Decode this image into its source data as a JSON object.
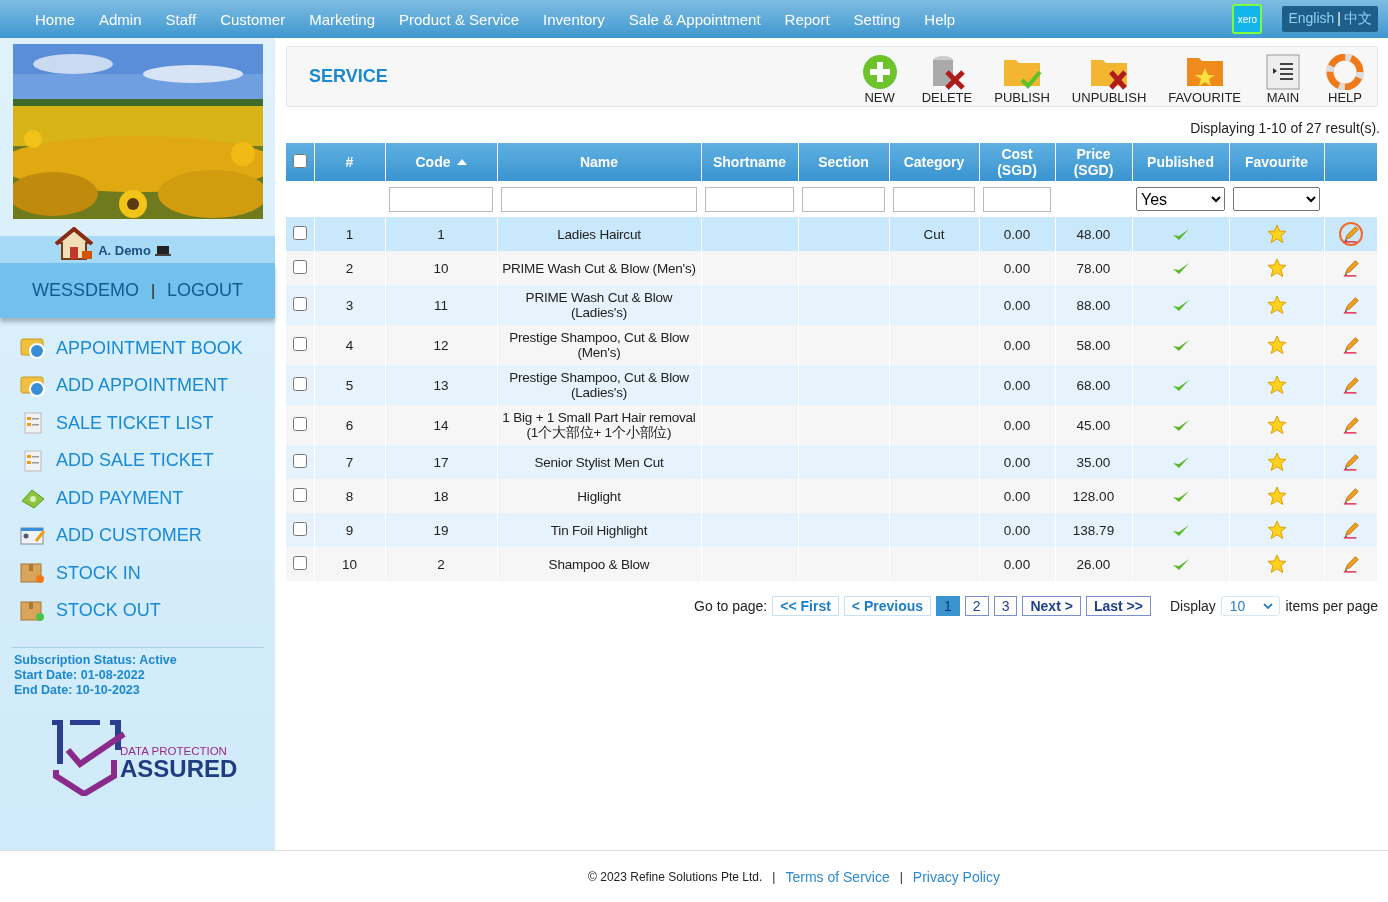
{
  "nav": {
    "items": [
      "Home",
      "Admin",
      "Staff",
      "Customer",
      "Marketing",
      "Product & Service",
      "Inventory",
      "Sale & Appointment",
      "Report",
      "Setting",
      "Help"
    ],
    "xero": "xero",
    "languages": [
      "English",
      "中文"
    ],
    "language_separator": "|"
  },
  "sidebar": {
    "user_name": "A. Demo",
    "account": "WESSDEMO",
    "separator": "|",
    "logout": "LOGOUT",
    "menu": [
      {
        "label": "APPOINTMENT BOOK",
        "kind": "calendar"
      },
      {
        "label": "ADD APPOINTMENT",
        "kind": "calendar"
      },
      {
        "label": "SALE TICKET LIST",
        "kind": "ticket"
      },
      {
        "label": "ADD SALE TICKET",
        "kind": "ticket"
      },
      {
        "label": "ADD PAYMENT",
        "kind": "money"
      },
      {
        "label": "ADD CUSTOMER",
        "kind": "card"
      },
      {
        "label": "STOCK IN",
        "kind": "stock-in"
      },
      {
        "label": "STOCK OUT",
        "kind": "stock-out"
      }
    ],
    "subscription": [
      "Subscription Status: Active",
      "Start Date: 01-08-2022",
      "End Date: 10-10-2023"
    ],
    "badge_top": "DATA PROTECTION",
    "badge_main": "ASSURED"
  },
  "toolbar": {
    "title": "SERVICE",
    "buttons": [
      {
        "label": "NEW",
        "kind": "new"
      },
      {
        "label": "DELETE",
        "kind": "delete"
      },
      {
        "label": "PUBLISH",
        "kind": "publish"
      },
      {
        "label": "UNPUBLISH",
        "kind": "unpublish"
      },
      {
        "label": "FAVOURITE",
        "kind": "favourite"
      },
      {
        "label": "MAIN",
        "kind": "main"
      },
      {
        "label": "HELP",
        "kind": "help"
      }
    ]
  },
  "table": {
    "result_text": "Displaying 1-10 of 27 result(s).",
    "all_checked": false,
    "columns": [
      {
        "label": "#"
      },
      {
        "label": "Code",
        "sorted": true
      },
      {
        "label": "Name"
      },
      {
        "label": "Shortname"
      },
      {
        "label": "Section"
      },
      {
        "label": "Category"
      },
      {
        "label": "Cost\n(SGD)"
      },
      {
        "label": "Price\n(SGD)"
      },
      {
        "label": "Published"
      },
      {
        "label": "Favourite"
      }
    ],
    "filters": [
      {
        "kind": "none"
      },
      {
        "kind": "text"
      },
      {
        "kind": "text"
      },
      {
        "kind": "text"
      },
      {
        "kind": "text"
      },
      {
        "kind": "text"
      },
      {
        "kind": "text"
      },
      {
        "kind": "none"
      },
      {
        "kind": "select",
        "value": "Yes"
      },
      {
        "kind": "select"
      }
    ],
    "rows": [
      {
        "number": "1",
        "code": "1",
        "name": "Ladies Haircut",
        "category": "Cut",
        "cost": "0.00",
        "price": "48.00",
        "published": true,
        "favourite": true,
        "checked": false,
        "selected": true
      },
      {
        "number": "2",
        "code": "10",
        "name": "PRIME Wash Cut & Blow (Men's)",
        "cost": "0.00",
        "price": "78.00",
        "published": true,
        "favourite": true,
        "checked": false,
        "selected": false
      },
      {
        "number": "3",
        "code": "11",
        "name": "PRIME Wash Cut & Blow (Ladies's)",
        "cost": "0.00",
        "price": "88.00",
        "published": true,
        "favourite": true,
        "checked": false,
        "selected": false
      },
      {
        "number": "4",
        "code": "12",
        "name": "Prestige Shampoo, Cut & Blow (Men's)",
        "cost": "0.00",
        "price": "58.00",
        "published": true,
        "favourite": true,
        "checked": false,
        "selected": false
      },
      {
        "number": "5",
        "code": "13",
        "name": "Prestige Shampoo, Cut & Blow (Ladies's)",
        "cost": "0.00",
        "price": "68.00",
        "published": true,
        "favourite": true,
        "checked": false,
        "selected": false
      },
      {
        "number": "6",
        "code": "14",
        "name": "1 Big + 1 Small Part Hair removal (1个大部位+ 1个小部位)",
        "cost": "0.00",
        "price": "45.00",
        "published": true,
        "favourite": true,
        "checked": false,
        "selected": false
      },
      {
        "number": "7",
        "code": "17",
        "name": "Senior Stylist Men Cut",
        "cost": "0.00",
        "price": "35.00",
        "published": true,
        "favourite": true,
        "checked": false,
        "selected": false
      },
      {
        "number": "8",
        "code": "18",
        "name": "Higlight",
        "cost": "0.00",
        "price": "128.00",
        "published": true,
        "favourite": true,
        "checked": false,
        "selected": false
      },
      {
        "number": "9",
        "code": "19",
        "name": "Tin Foil Highlight",
        "cost": "0.00",
        "price": "138.79",
        "published": true,
        "favourite": true,
        "checked": false,
        "selected": false
      },
      {
        "number": "10",
        "code": "2",
        "name": "Shampoo & Blow",
        "cost": "0.00",
        "price": "26.00",
        "published": true,
        "favourite": true,
        "checked": false,
        "selected": false
      }
    ]
  },
  "pagination": {
    "label": "Go to page:",
    "first": "<< First",
    "previous": "< Previous",
    "pages": [
      {
        "label": "1",
        "selected": true
      },
      {
        "label": "2",
        "selected": false
      },
      {
        "label": "3",
        "selected": false
      }
    ],
    "next": "Next >",
    "last": "Last >>",
    "display": "Display",
    "per_page": "10",
    "suffix": "items per page"
  },
  "footer": {
    "copyright": "© 2023 Refine Solutions Pte Ltd.",
    "separator": "|",
    "links": [
      "Terms of Service",
      "Privacy Policy"
    ]
  }
}
